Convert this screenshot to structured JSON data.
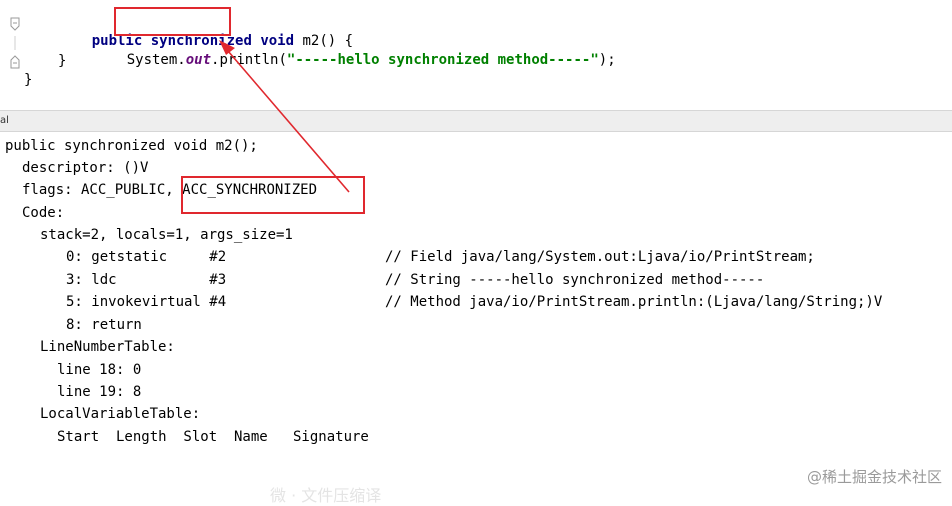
{
  "editor": {
    "line1": {
      "kw1": "public",
      "kw2": "synchronized",
      "kw3": "void",
      "name": " m2() {"
    },
    "line2": {
      "prefix": "System.",
      "field": "out",
      "call": ".println(",
      "string": "\"-----hello synchronized method-----\"",
      "suffix": ");"
    },
    "line3": "}",
    "line4": "}"
  },
  "panel": {
    "label": "al"
  },
  "bytecode": {
    "signature": "public synchronized void m2();",
    "descriptor": "descriptor: ()V",
    "flags_prefix": "flags: ACC_PUBLIC, ",
    "flags_sync": "ACC_SYNCHRONIZED",
    "code_label": "Code:",
    "stack": "stack=2, locals=1, args_size=1",
    "instructions": [
      {
        "op": "0: getstatic     #2",
        "comment": "// Field java/lang/System.out:Ljava/io/PrintStream;"
      },
      {
        "op": "3: ldc           #3",
        "comment": "// String -----hello synchronized method-----"
      },
      {
        "op": "5: invokevirtual #4",
        "comment": "// Method java/io/PrintStream.println:(Ljava/lang/String;)V"
      },
      {
        "op": "8: return",
        "comment": ""
      }
    ],
    "line_number_table": "LineNumberTable:",
    "line_numbers": [
      "line 18: 0",
      "line 19: 8"
    ],
    "local_variable_table": "LocalVariableTable:",
    "lvt_header": "Start  Length  Slot  Name   Signature"
  },
  "watermark": "@稀土掘金技术社区",
  "faint_text": "微 · 文件压缩译",
  "colors": {
    "highlight": "#e0282e",
    "keyword": "#000080",
    "string": "#008000",
    "field": "#660e7a"
  }
}
